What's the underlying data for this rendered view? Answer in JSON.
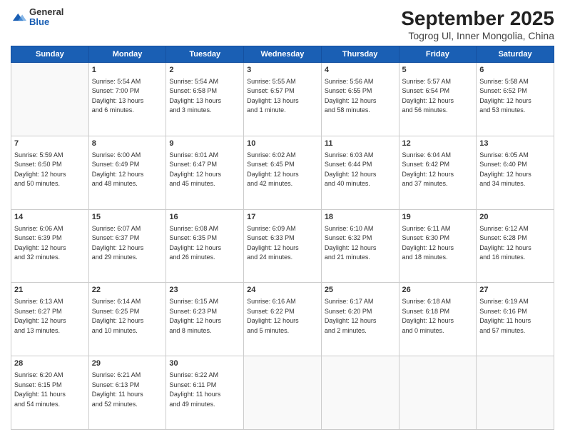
{
  "header": {
    "logo_general": "General",
    "logo_blue": "Blue",
    "title": "September 2025",
    "subtitle": "Togrog Ul, Inner Mongolia, China"
  },
  "weekdays": [
    "Sunday",
    "Monday",
    "Tuesday",
    "Wednesday",
    "Thursday",
    "Friday",
    "Saturday"
  ],
  "weeks": [
    [
      {
        "day": "",
        "info": ""
      },
      {
        "day": "1",
        "info": "Sunrise: 5:54 AM\nSunset: 7:00 PM\nDaylight: 13 hours\nand 6 minutes."
      },
      {
        "day": "2",
        "info": "Sunrise: 5:54 AM\nSunset: 6:58 PM\nDaylight: 13 hours\nand 3 minutes."
      },
      {
        "day": "3",
        "info": "Sunrise: 5:55 AM\nSunset: 6:57 PM\nDaylight: 13 hours\nand 1 minute."
      },
      {
        "day": "4",
        "info": "Sunrise: 5:56 AM\nSunset: 6:55 PM\nDaylight: 12 hours\nand 58 minutes."
      },
      {
        "day": "5",
        "info": "Sunrise: 5:57 AM\nSunset: 6:54 PM\nDaylight: 12 hours\nand 56 minutes."
      },
      {
        "day": "6",
        "info": "Sunrise: 5:58 AM\nSunset: 6:52 PM\nDaylight: 12 hours\nand 53 minutes."
      }
    ],
    [
      {
        "day": "7",
        "info": "Sunrise: 5:59 AM\nSunset: 6:50 PM\nDaylight: 12 hours\nand 50 minutes."
      },
      {
        "day": "8",
        "info": "Sunrise: 6:00 AM\nSunset: 6:49 PM\nDaylight: 12 hours\nand 48 minutes."
      },
      {
        "day": "9",
        "info": "Sunrise: 6:01 AM\nSunset: 6:47 PM\nDaylight: 12 hours\nand 45 minutes."
      },
      {
        "day": "10",
        "info": "Sunrise: 6:02 AM\nSunset: 6:45 PM\nDaylight: 12 hours\nand 42 minutes."
      },
      {
        "day": "11",
        "info": "Sunrise: 6:03 AM\nSunset: 6:44 PM\nDaylight: 12 hours\nand 40 minutes."
      },
      {
        "day": "12",
        "info": "Sunrise: 6:04 AM\nSunset: 6:42 PM\nDaylight: 12 hours\nand 37 minutes."
      },
      {
        "day": "13",
        "info": "Sunrise: 6:05 AM\nSunset: 6:40 PM\nDaylight: 12 hours\nand 34 minutes."
      }
    ],
    [
      {
        "day": "14",
        "info": "Sunrise: 6:06 AM\nSunset: 6:39 PM\nDaylight: 12 hours\nand 32 minutes."
      },
      {
        "day": "15",
        "info": "Sunrise: 6:07 AM\nSunset: 6:37 PM\nDaylight: 12 hours\nand 29 minutes."
      },
      {
        "day": "16",
        "info": "Sunrise: 6:08 AM\nSunset: 6:35 PM\nDaylight: 12 hours\nand 26 minutes."
      },
      {
        "day": "17",
        "info": "Sunrise: 6:09 AM\nSunset: 6:33 PM\nDaylight: 12 hours\nand 24 minutes."
      },
      {
        "day": "18",
        "info": "Sunrise: 6:10 AM\nSunset: 6:32 PM\nDaylight: 12 hours\nand 21 minutes."
      },
      {
        "day": "19",
        "info": "Sunrise: 6:11 AM\nSunset: 6:30 PM\nDaylight: 12 hours\nand 18 minutes."
      },
      {
        "day": "20",
        "info": "Sunrise: 6:12 AM\nSunset: 6:28 PM\nDaylight: 12 hours\nand 16 minutes."
      }
    ],
    [
      {
        "day": "21",
        "info": "Sunrise: 6:13 AM\nSunset: 6:27 PM\nDaylight: 12 hours\nand 13 minutes."
      },
      {
        "day": "22",
        "info": "Sunrise: 6:14 AM\nSunset: 6:25 PM\nDaylight: 12 hours\nand 10 minutes."
      },
      {
        "day": "23",
        "info": "Sunrise: 6:15 AM\nSunset: 6:23 PM\nDaylight: 12 hours\nand 8 minutes."
      },
      {
        "day": "24",
        "info": "Sunrise: 6:16 AM\nSunset: 6:22 PM\nDaylight: 12 hours\nand 5 minutes."
      },
      {
        "day": "25",
        "info": "Sunrise: 6:17 AM\nSunset: 6:20 PM\nDaylight: 12 hours\nand 2 minutes."
      },
      {
        "day": "26",
        "info": "Sunrise: 6:18 AM\nSunset: 6:18 PM\nDaylight: 12 hours\nand 0 minutes."
      },
      {
        "day": "27",
        "info": "Sunrise: 6:19 AM\nSunset: 6:16 PM\nDaylight: 11 hours\nand 57 minutes."
      }
    ],
    [
      {
        "day": "28",
        "info": "Sunrise: 6:20 AM\nSunset: 6:15 PM\nDaylight: 11 hours\nand 54 minutes."
      },
      {
        "day": "29",
        "info": "Sunrise: 6:21 AM\nSunset: 6:13 PM\nDaylight: 11 hours\nand 52 minutes."
      },
      {
        "day": "30",
        "info": "Sunrise: 6:22 AM\nSunset: 6:11 PM\nDaylight: 11 hours\nand 49 minutes."
      },
      {
        "day": "",
        "info": ""
      },
      {
        "day": "",
        "info": ""
      },
      {
        "day": "",
        "info": ""
      },
      {
        "day": "",
        "info": ""
      }
    ]
  ]
}
